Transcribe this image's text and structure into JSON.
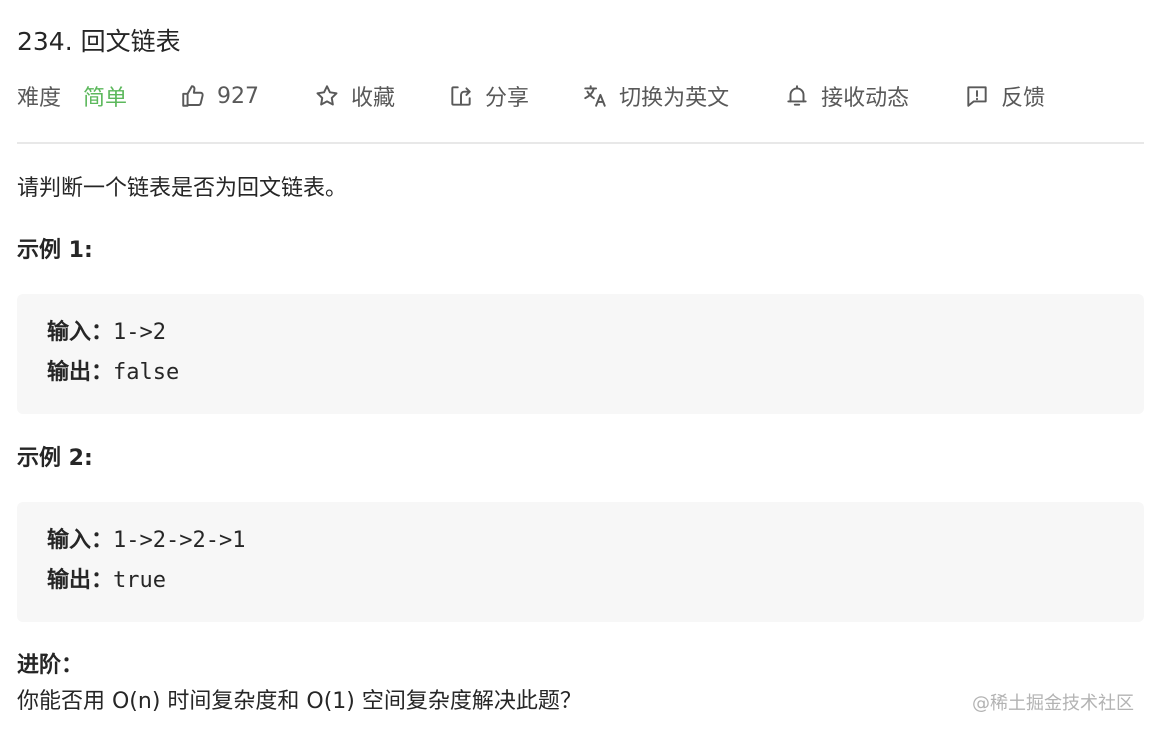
{
  "problem": {
    "title": "234. 回文链表"
  },
  "meta": {
    "difficulty_label": "难度",
    "difficulty_value": "简单",
    "like_count": "927",
    "favorite_label": "收藏",
    "share_label": "分享",
    "switch_lang_label": "切换为英文",
    "notify_label": "接收动态",
    "feedback_label": "反馈",
    "icons": {
      "like": "thumbs-up-icon",
      "favorite": "star-icon",
      "share": "share-icon",
      "switch_lang": "translate-icon",
      "notify": "bell-icon",
      "feedback": "message-alert-icon"
    },
    "colors": {
      "difficulty": "#5cb85c",
      "text": "#595959"
    }
  },
  "content": {
    "description": "请判断一个链表是否为回文链表。",
    "examples": [
      {
        "title": "示例 1:",
        "input_label": "输入：",
        "input_value": "1->2",
        "output_label": "输出：",
        "output_value": "false"
      },
      {
        "title": "示例 2:",
        "input_label": "输入：",
        "input_value": "1->2->2->1",
        "output_label": "输出：",
        "output_value": "true"
      }
    ],
    "advanced_title": "进阶：",
    "advanced_text": "你能否用 O(n) 时间复杂度和 O(1) 空间复杂度解决此题？"
  },
  "watermark": "@稀土掘金技术社区"
}
